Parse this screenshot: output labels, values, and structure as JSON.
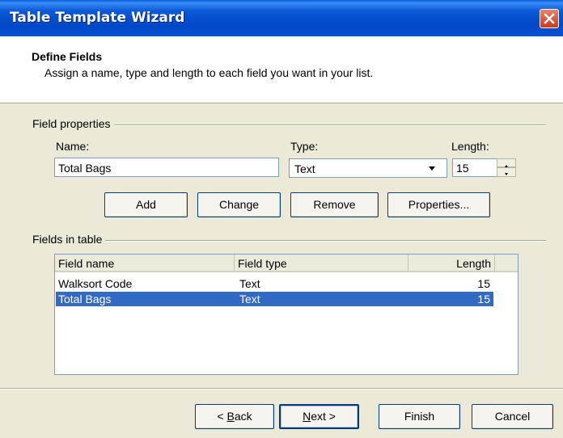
{
  "window": {
    "title": "Table Template Wizard"
  },
  "header": {
    "title": "Define Fields",
    "subtitle": "Assign a name, type and length to each field you want in your list."
  },
  "field_properties": {
    "group_label": "Field properties",
    "name_label": "Name:",
    "name_value": "Total Bags",
    "type_label": "Type:",
    "type_value": "Text",
    "length_label": "Length:",
    "length_value": "15",
    "buttons": {
      "add": "Add",
      "change": "Change",
      "remove": "Remove",
      "properties": "Properties..."
    }
  },
  "fields_in_table": {
    "group_label": "Fields in table",
    "columns": [
      "Field name",
      "Field type",
      "Length"
    ],
    "rows": [
      {
        "name": "Walksort Code",
        "type": "Text",
        "length": "15",
        "selected": false
      },
      {
        "name": "Total Bags",
        "type": "Text",
        "length": "15",
        "selected": true
      }
    ]
  },
  "footer": {
    "back_pre": "< ",
    "back_accel": "B",
    "back_post": "ack",
    "next_accel": "N",
    "next_post": "ext >",
    "finish": "Finish",
    "cancel": "Cancel"
  },
  "colors": {
    "title_bar": "#0054e3",
    "selection": "#316ac5",
    "dialog_bg": "#ece9d8"
  },
  "icons": {
    "close": "close-icon",
    "combo": "chevron-down-icon",
    "spin_up": "spin-up-icon",
    "spin_down": "spin-down-icon"
  }
}
